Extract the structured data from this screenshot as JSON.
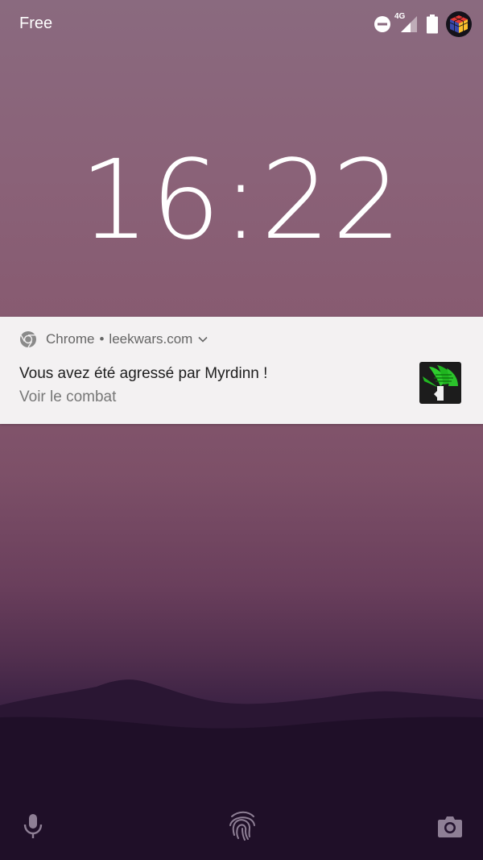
{
  "status_bar": {
    "carrier": "Free",
    "network": "4G",
    "icons": [
      "do-not-disturb-icon",
      "signal-icon",
      "battery-icon",
      "avatar"
    ]
  },
  "lock_screen": {
    "time": "16:22"
  },
  "notification": {
    "app": "Chrome",
    "separator": "•",
    "source": "leekwars.com",
    "title": "Vous avez été agressé par Myrdinn !",
    "text": "Voir le combat",
    "icons": [
      "chrome-icon",
      "expand-chevron-icon",
      "leek-thumbnail"
    ]
  },
  "bottom_bar": {
    "icons": [
      "microphone-icon",
      "fingerprint-icon",
      "camera-icon"
    ]
  },
  "colors": {
    "notification_bg": "#f3f1f2",
    "sky_top": "#8a6a7f",
    "sky_bottom": "#24132f"
  }
}
